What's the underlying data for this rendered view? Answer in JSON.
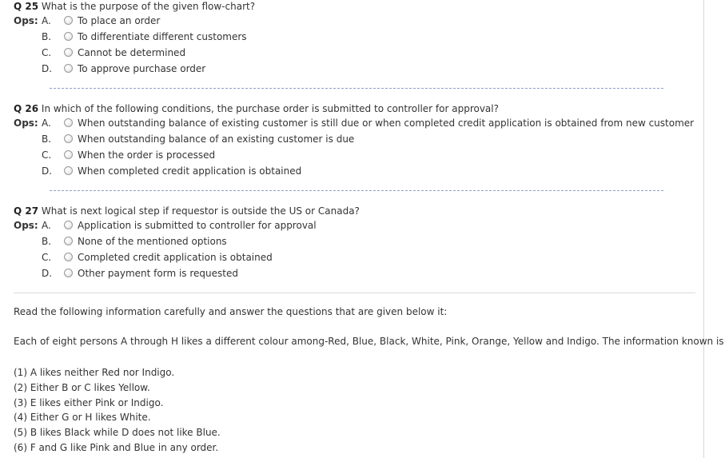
{
  "ops_label": "Ops:",
  "questions": [
    {
      "number": "Q 25",
      "text": "What is the purpose of the given flow-chart?",
      "options": [
        {
          "letter": "A.",
          "text": "To place an order"
        },
        {
          "letter": "B.",
          "text": "To differentiate different customers"
        },
        {
          "letter": "C.",
          "text": "Cannot be determined"
        },
        {
          "letter": "D.",
          "text": "To approve purchase order"
        }
      ]
    },
    {
      "number": "Q 26",
      "text": "In which of the following conditions, the purchase order is submitted to controller for approval?",
      "options": [
        {
          "letter": "A.",
          "text": "When outstanding balance of existing customer is still due or when completed credit application is obtained from new customer"
        },
        {
          "letter": "B.",
          "text": "When outstanding balance of an existing customer is due"
        },
        {
          "letter": "C.",
          "text": "When the order is processed"
        },
        {
          "letter": "D.",
          "text": "When completed credit application is obtained"
        }
      ]
    },
    {
      "number": "Q 27",
      "text": "What is next logical step if requestor is outside the US or Canada?",
      "options": [
        {
          "letter": "A.",
          "text": "Application is submitted to controller for approval"
        },
        {
          "letter": "B.",
          "text": "None of the mentioned options"
        },
        {
          "letter": "C.",
          "text": "Completed credit application is obtained"
        },
        {
          "letter": "D.",
          "text": "Other payment form is requested"
        }
      ]
    }
  ],
  "passage": {
    "intro": "Read the following information carefully and answer the questions that are given below it:",
    "statement": "Each of eight persons A through H likes a different colour among-Red, Blue, Black, White, Pink, Orange, Yellow and Indigo. The information known is:",
    "clues": [
      "(1) A likes neither Red nor Indigo.",
      "(2) Either B or C likes Yellow.",
      "(3) E likes either Pink or Indigo.",
      "(4) Either G or H likes White.",
      "(5) B likes Black while D does not like Blue.",
      "(6) F and G like Pink and Blue in any order."
    ]
  }
}
